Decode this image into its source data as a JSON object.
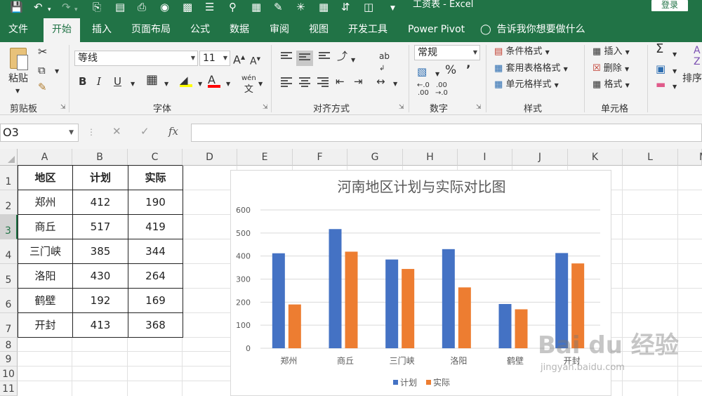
{
  "window": {
    "title": "工资表 - Excel",
    "login_label": "登录"
  },
  "quick_access": {
    "icons": [
      "save-icon",
      "undo-icon",
      "redo-icon",
      "print-preview-icon",
      "print-icon",
      "camera-icon",
      "chart-icon",
      "form-icon",
      "find-icon",
      "calculator-icon",
      "edit-icon",
      "sparkle-icon",
      "grid-icon",
      "sort-icon",
      "filter-icon",
      "customize-icon"
    ]
  },
  "tabs": [
    {
      "label": "文件",
      "active": false
    },
    {
      "label": "开始",
      "active": true
    },
    {
      "label": "插入",
      "active": false
    },
    {
      "label": "页面布局",
      "active": false
    },
    {
      "label": "公式",
      "active": false
    },
    {
      "label": "数据",
      "active": false
    },
    {
      "label": "审阅",
      "active": false
    },
    {
      "label": "视图",
      "active": false
    },
    {
      "label": "开发工具",
      "active": false
    },
    {
      "label": "Power Pivot",
      "active": false
    }
  ],
  "tell_me": "告诉我你想要做什么",
  "ribbon": {
    "clipboard": {
      "label": "剪贴板",
      "paste": "粘贴"
    },
    "font": {
      "label": "字体",
      "font_name": "等线",
      "font_size": "11",
      "phonetic": "wén"
    },
    "alignment": {
      "label": "对齐方式",
      "wrap": "ab"
    },
    "number": {
      "label": "数字",
      "format": "常规",
      "percent": "%",
      "comma": "’",
      "inc_decimal_a": "←.0",
      "inc_decimal_b": ".00",
      "dec_decimal_a": ".00",
      "dec_decimal_b": "→.0"
    },
    "styles": {
      "label": "样式",
      "conditional": "条件格式",
      "table": "套用表格格式",
      "cell": "单元格样式"
    },
    "cells": {
      "label": "单元格",
      "insert": "插入",
      "delete": "删除",
      "format": "格式"
    },
    "editing": {
      "sort": "排序",
      "sum": "Σ"
    }
  },
  "formula_bar": {
    "name_box": "O3",
    "cancel": "✕",
    "enter": "✓",
    "fx": "fx",
    "value": ""
  },
  "grid": {
    "columns": [
      "A",
      "B",
      "C",
      "D",
      "E",
      "F",
      "G",
      "H",
      "I",
      "J",
      "K",
      "L",
      "M"
    ],
    "rows": [
      "1",
      "2",
      "3",
      "4",
      "5",
      "6",
      "7",
      "8",
      "9",
      "10",
      "11"
    ],
    "selected_row": "3",
    "table": {
      "headers": [
        "地区",
        "计划",
        "实际"
      ],
      "rows": [
        [
          "郑州",
          "412",
          "190"
        ],
        [
          "商丘",
          "517",
          "419"
        ],
        [
          "三门峡",
          "385",
          "344"
        ],
        [
          "洛阳",
          "430",
          "264"
        ],
        [
          "鹤壁",
          "192",
          "169"
        ],
        [
          "开封",
          "413",
          "368"
        ]
      ]
    }
  },
  "chart_data": {
    "type": "bar",
    "title": "河南地区计划与实际对比图",
    "categories": [
      "郑州",
      "商丘",
      "三门峡",
      "洛阳",
      "鹤壁",
      "开封"
    ],
    "series": [
      {
        "name": "计划",
        "values": [
          412,
          517,
          385,
          430,
          192,
          413
        ],
        "color": "#4472C4"
      },
      {
        "name": "实际",
        "values": [
          190,
          419,
          344,
          264,
          169,
          368
        ],
        "color": "#ED7D31"
      }
    ],
    "ylim": [
      0,
      600
    ],
    "yticks": [
      0,
      100,
      200,
      300,
      400,
      500,
      600
    ],
    "grid": true,
    "legend": "bottom",
    "xlabel": "",
    "ylabel": ""
  },
  "watermark": {
    "brand": "Bai du 经验",
    "url": "jingyan.baidu.com"
  },
  "colors": {
    "excel_green": "#217346",
    "ribbon_bg": "#f3f3f3",
    "series_plan": "#4472C4",
    "series_actual": "#ED7D31"
  }
}
